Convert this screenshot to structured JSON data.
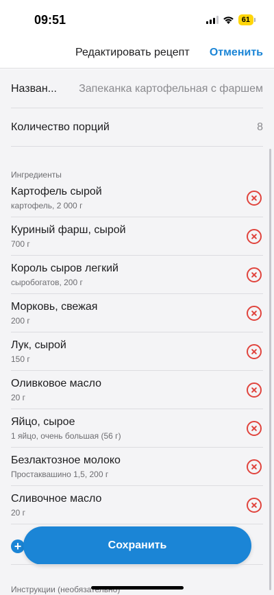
{
  "status_bar": {
    "time": "09:51",
    "battery": "61"
  },
  "nav": {
    "title": "Редактировать рецепт",
    "cancel_label": "Отменить"
  },
  "fields": {
    "name_label": "Назван...",
    "name_value": "Запеканка картофельная с фаршем",
    "servings_label": "Количество порций",
    "servings_value": "8"
  },
  "ingredients_section": {
    "label": "Ингредиенты",
    "items": [
      {
        "name": "Картофель сырой",
        "detail": "картофель, 2 000 г"
      },
      {
        "name": "Куриный фарш, сырой",
        "detail": "700 г"
      },
      {
        "name": "Король сыров легкий",
        "detail": "сыробогатов, 200 г"
      },
      {
        "name": "Морковь, свежая",
        "detail": "200 г"
      },
      {
        "name": "Лук, сырой",
        "detail": "150 г"
      },
      {
        "name": "Оливковое масло",
        "detail": "20 г"
      },
      {
        "name": "Яйцо, сырое",
        "detail": "1 яйцо, очень большая (56 г)"
      },
      {
        "name": "Безлактозное молоко",
        "detail": "Простаквашино 1,5, 200 г"
      },
      {
        "name": "Сливочное масло",
        "detail": "20 г"
      }
    ]
  },
  "add_icon": "plus-icon",
  "remove_icon": "remove-circle-icon",
  "save_label": "Сохранить",
  "instructions_label": "Инструкции (необязательно)",
  "colors": {
    "accent": "#1b85d6",
    "danger": "#e0433c",
    "background_gray": "#f4f4f6"
  }
}
